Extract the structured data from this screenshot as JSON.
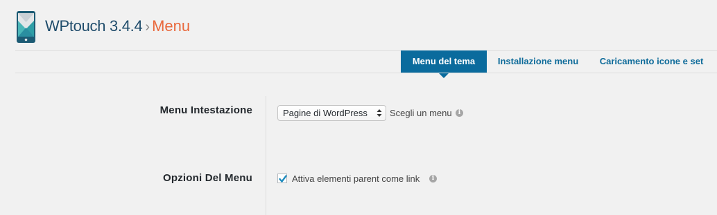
{
  "header": {
    "product": "WPtouch 3.4.4",
    "separator": "›",
    "section": "Menu"
  },
  "tabs": [
    {
      "label": "Menu del tema",
      "active": true
    },
    {
      "label": "Installazione menu",
      "active": false
    },
    {
      "label": "Caricamento icone e set",
      "active": false
    }
  ],
  "settings": {
    "header_menu": {
      "label": "Menu Intestazione",
      "select_value": "Pagine di WordPress",
      "hint": "Scegli un menu"
    },
    "menu_options": {
      "label": "Opzioni Del Menu",
      "checkbox_checked": true,
      "checkbox_label": "Attiva elementi parent come link"
    }
  },
  "icons": {
    "logo": "wptouch-logo",
    "info": "info-icon",
    "check": "checkmark-icon",
    "select_arrows": "chevron-updown-icon"
  },
  "colors": {
    "accent": "#0a6b9d",
    "section_title": "#e9693d",
    "product_title": "#1f4c6b"
  }
}
